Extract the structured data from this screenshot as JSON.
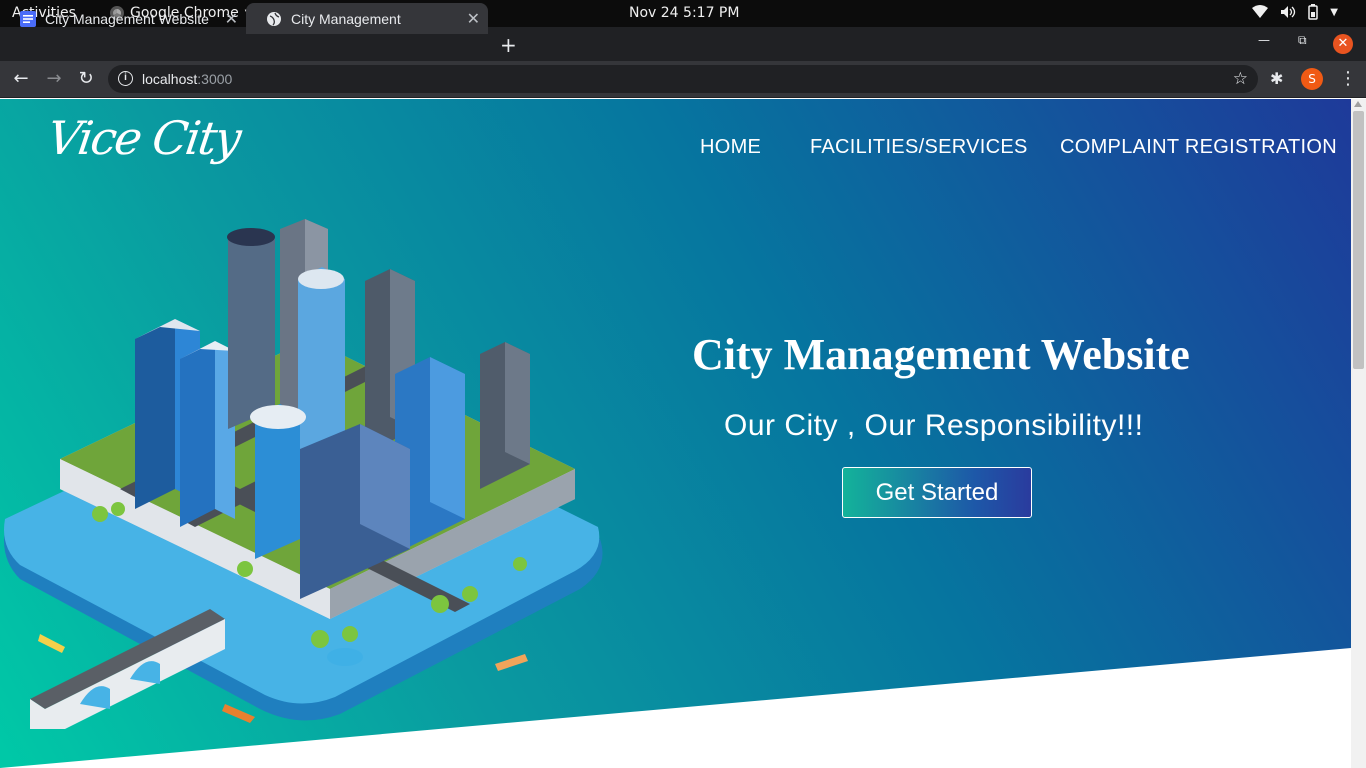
{
  "os_bar": {
    "activities": "Activities",
    "app_name": "Google Chrome",
    "clock": "Nov 24  5:17 PM"
  },
  "browser": {
    "tabs": [
      {
        "title": "City Management Website"
      },
      {
        "title": "City Management"
      }
    ],
    "address": {
      "host": "localhost",
      "port": ":3000"
    },
    "profile_initial": "S"
  },
  "page": {
    "logo": "Vice City",
    "nav": {
      "home": "HOME",
      "services": "FACILITIES/SERVICES",
      "complaint": "COMPLAINT REGISTRATION"
    },
    "hero": {
      "title": "City Management Website",
      "subtitle": "Our City , Our Responsibility!!!",
      "cta": "Get Started"
    }
  },
  "colors": {
    "hero_gradient_start": "#00c9a7",
    "hero_gradient_end": "#1e3a9a",
    "ubuntu_orange": "#e95420"
  }
}
